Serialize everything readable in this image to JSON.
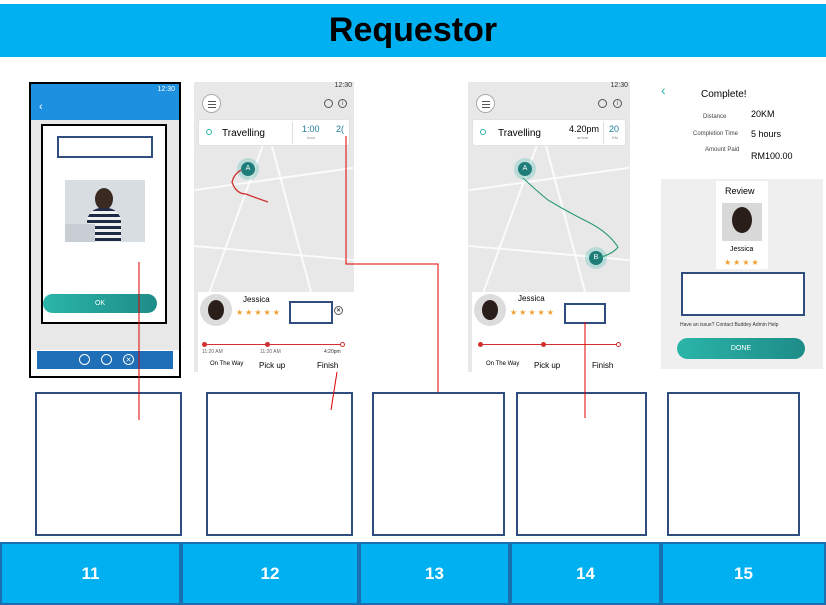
{
  "title": "Requestor",
  "status_time": "12:30",
  "screens": {
    "s11": {
      "ok_label": "OK"
    },
    "s12": {
      "status_label": "Travelling",
      "time_value": "1:00",
      "time_unit": "hour",
      "distance_value": "2(",
      "marker_a": "A",
      "driver_name": "Jessica",
      "stars": "★★★★★",
      "timeline_times": [
        "11:20 AM",
        "11:20 AM",
        "4:20pm"
      ],
      "steps": [
        "On The Way",
        "Pick up",
        "Finish"
      ]
    },
    "s14": {
      "status_label": "Travelling",
      "time_value": "4.20pm",
      "time_sub": "arrival",
      "distance_value": "20",
      "distance_unit": "KM",
      "marker_a": "A",
      "marker_b": "B",
      "driver_name": "Jessica",
      "stars": "★★★★★",
      "steps": [
        "On The Way",
        "Pick up",
        "Finish"
      ]
    },
    "s15": {
      "heading": "Complete!",
      "distance_label": "Distance",
      "distance_value": "20KM",
      "completion_label": "Completion Time",
      "completion_value": "5 hours",
      "amount_label": "Amount Paid",
      "amount_value": "RM100.00",
      "review_title": "Review",
      "reviewer_name": "Jessica",
      "stars": "★★★★",
      "help_text": "Have an issue? Contact Buddey Admin Help",
      "done_label": "DONE"
    }
  },
  "step_numbers": [
    "11",
    "12",
    "13",
    "14",
    "15"
  ],
  "colors": {
    "banner": "#00b0f0",
    "teal": "#2ab5a8",
    "connector": "#e00000",
    "box_border": "#2f4d7e"
  }
}
